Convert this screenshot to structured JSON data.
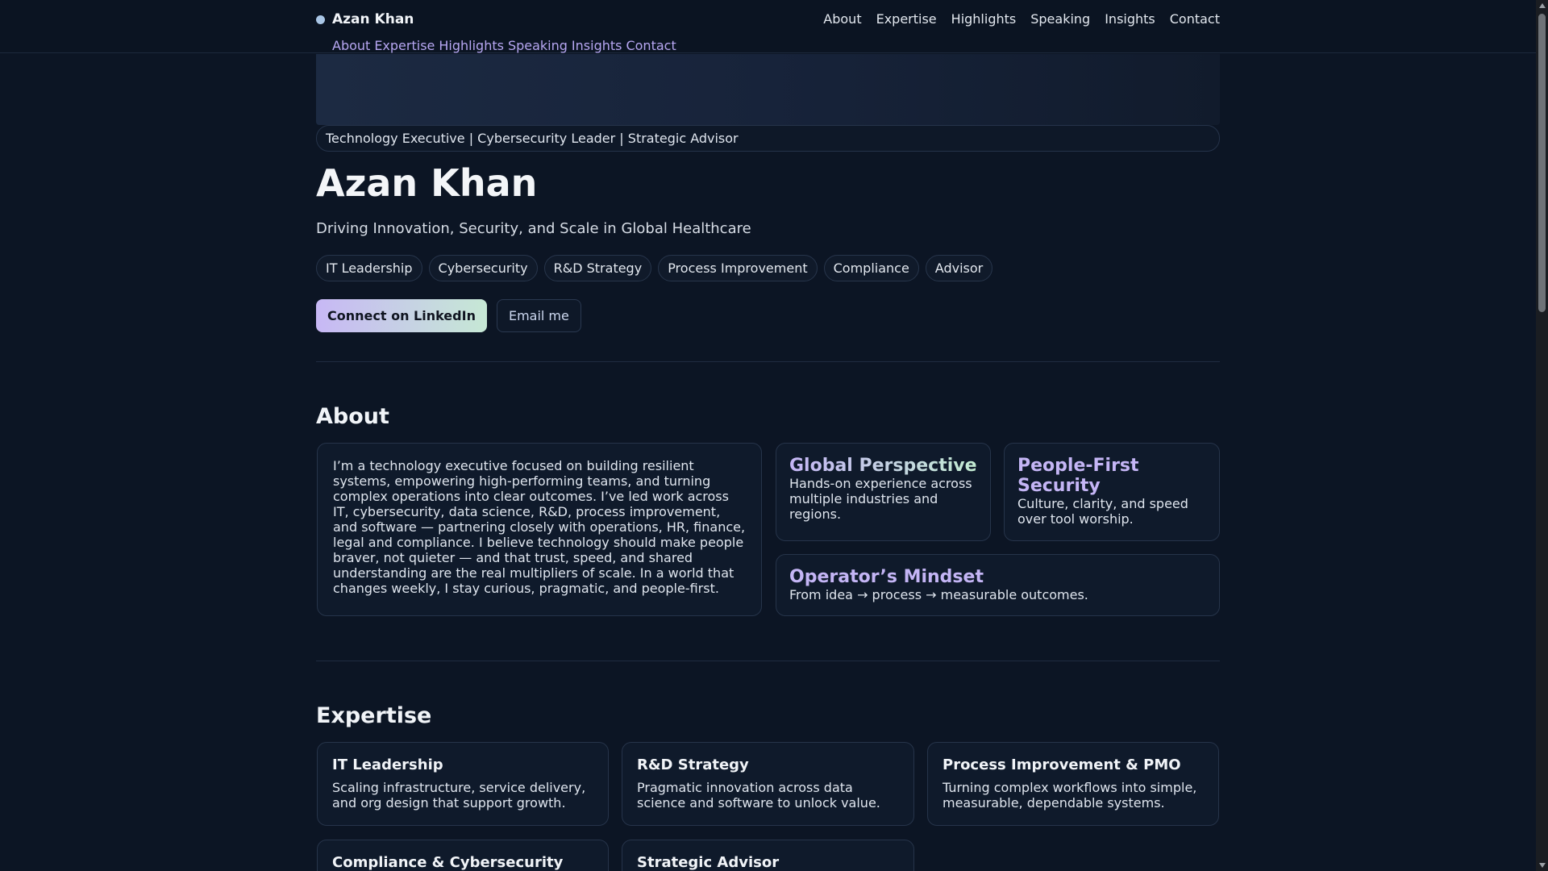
{
  "brand": {
    "name": "Azan Khan"
  },
  "nav": {
    "items": [
      "About",
      "Expertise",
      "Highlights",
      "Speaking",
      "Insights",
      "Contact"
    ]
  },
  "hero": {
    "tagline": "Technology Executive | Cybersecurity Leader | Strategic Advisor",
    "name": "Azan Khan",
    "subtitle": "Driving Innovation, Security, and Scale in Global Healthcare",
    "tags": [
      "IT Leadership",
      "Cybersecurity",
      "R&D Strategy",
      "Process Improvement",
      "Compliance",
      "Advisor"
    ],
    "primary_cta": "Connect on LinkedIn",
    "secondary_cta": "Email me"
  },
  "about": {
    "title": "About",
    "body": "I’m a technology executive focused on building resilient systems, empowering high-performing teams, and turning complex operations into clear outcomes. I’ve led work across IT, cybersecurity, data science, R&D, process improvement, and software — partnering closely with operations, HR, finance, legal and compliance. I believe technology should make people braver, not quieter — and that trust, speed, and shared understanding are the real multipliers of scale. In a world that changes weekly, I stay curious, pragmatic, and people-first.",
    "features": [
      {
        "title": "Global Perspective",
        "text": "Hands-on experience across multiple industries and regions."
      },
      {
        "title": "People-First Security",
        "text": "Culture, clarity, and speed over tool worship."
      },
      {
        "title": "Operator’s Mindset",
        "text": "From idea → process → measurable outcomes."
      }
    ]
  },
  "expertise": {
    "title": "Expertise",
    "cards": [
      {
        "title": "IT Leadership",
        "text": "Scaling infrastructure, service delivery, and org design that support growth."
      },
      {
        "title": "R&D Strategy",
        "text": "Pragmatic innovation across data science and software to unlock value."
      },
      {
        "title": "Process Improvement & PMO",
        "text": "Turning complex workflows into simple, measurable, dependable systems."
      },
      {
        "title": "Compliance & Cybersecurity",
        "text": ""
      },
      {
        "title": "Strategic Advisor",
        "text": ""
      }
    ]
  },
  "colors": {
    "background": "#0c1524",
    "accent_purple": "#c4b5f5",
    "accent_green": "#c3ecd2",
    "nav_secondary": "#b7a7f2"
  }
}
